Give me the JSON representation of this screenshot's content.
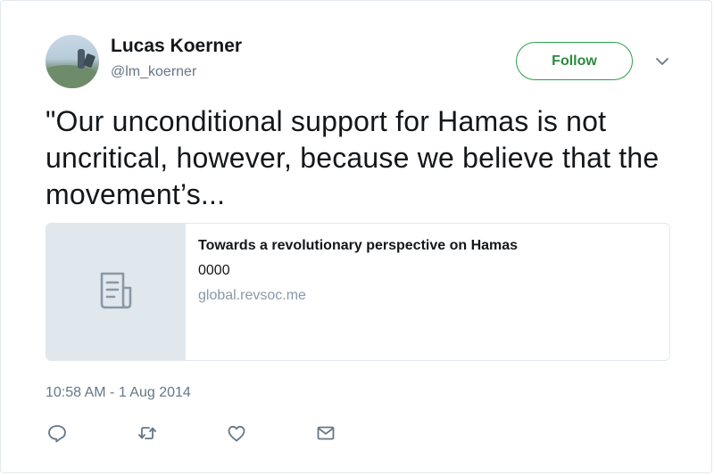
{
  "author": {
    "name": "Lucas Koerner",
    "handle": "@lm_koerner"
  },
  "follow_label": "Follow",
  "tweet_text": "\"Our unconditional support for Hamas is not uncritical, however, because we believe that the movement’s...",
  "card": {
    "title": "Towards a revolutionary perspective on Hamas",
    "description": "0000",
    "domain": "global.revsoc.me",
    "icon": "document-icon"
  },
  "timestamp": "10:58 AM - 1 Aug 2014",
  "actions": [
    "reply-icon",
    "retweet-icon",
    "like-icon",
    "direct-message-icon"
  ],
  "colors": {
    "follow_accent": "#2aa14c",
    "text_primary": "#14171a",
    "text_secondary": "#657786",
    "card_media_bg": "#e1e8ed"
  }
}
